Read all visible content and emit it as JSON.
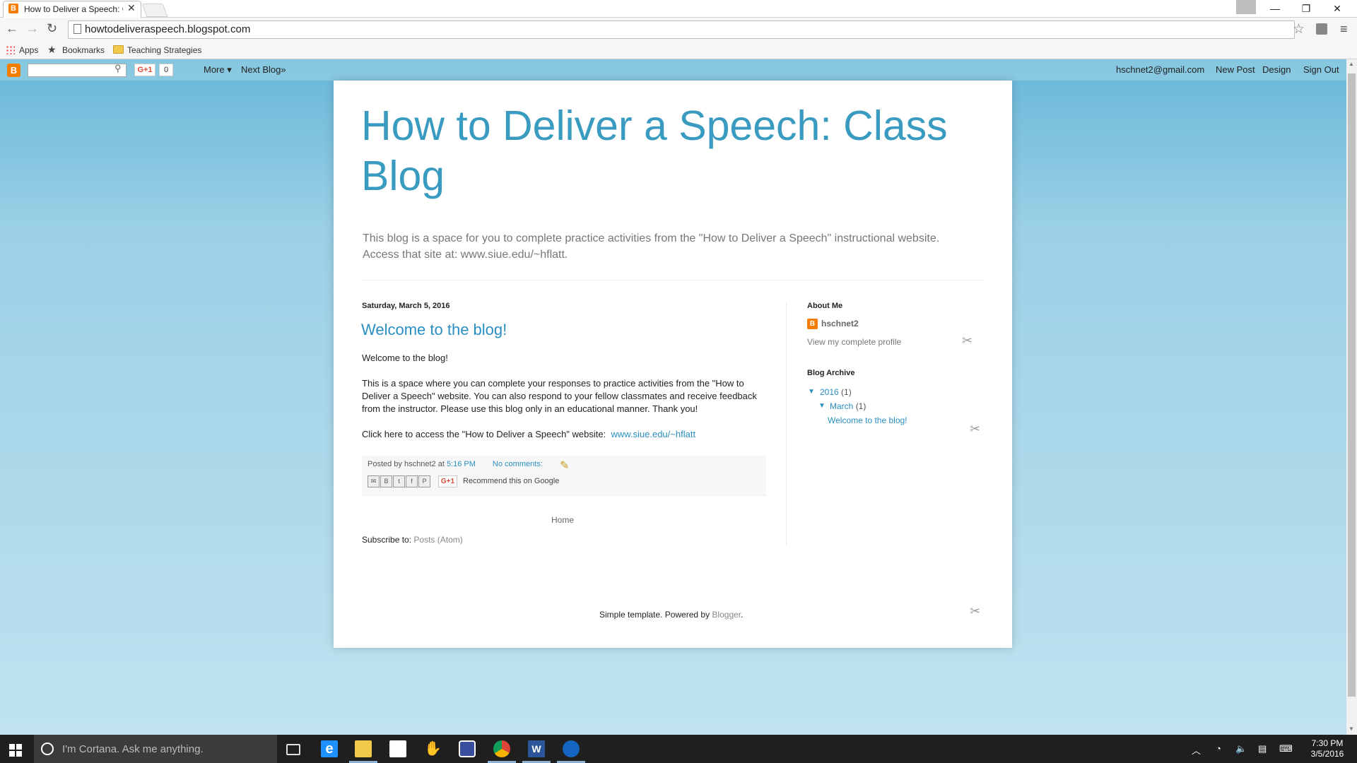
{
  "browser": {
    "tab_title": "How to Deliver a Speech: C",
    "url": "howtodeliveraspeech.blogspot.com",
    "bookmarks": [
      {
        "label": "Apps"
      },
      {
        "label": "Bookmarks"
      },
      {
        "label": "Teaching Strategies"
      }
    ]
  },
  "blogger_bar": {
    "gplus": "G+1",
    "count": "0",
    "more": "More ▾",
    "next_blog": "Next Blog»",
    "email": "hschnet2@gmail.com",
    "new_post": "New Post",
    "design": "Design",
    "sign_out": "Sign Out"
  },
  "blog": {
    "title": "How to Deliver a Speech: Class Blog",
    "description": "This blog is a space for you to complete practice activities from the \"How to Deliver a Speech\" instructional website. Access that site at: www.siue.edu/~hflatt."
  },
  "post": {
    "date": "Saturday, March 5, 2016",
    "title": "Welcome to the blog!",
    "p1": "Welcome to the blog!",
    "p2": "This is a space where you can complete your responses to practice activities from the \"How to Deliver a Speech\" website.  You can also respond to your fellow classmates and receive feedback from the instructor.  Please use this blog only in an educational manner.  Thank you!",
    "p3_prefix": "Click here to access the \"How to Deliver a Speech\" website:  ",
    "p3_link": "www.siue.edu/~hflatt",
    "posted_by_label": "Posted by",
    "author": "hschnet2",
    "at": "at",
    "time": "5:16 PM",
    "comments": "No comments:",
    "share_gplus": "G+1",
    "recommend": "Recommend this on Google"
  },
  "nav": {
    "home": "Home",
    "subscribe_label": "Subscribe to:",
    "subscribe_link": "Posts (Atom)"
  },
  "sidebar": {
    "about_heading": "About Me",
    "profile_name": "hschnet2",
    "profile_link": "View my complete profile",
    "archive_heading": "Blog Archive",
    "year": "2016",
    "year_count": "(1)",
    "month": "March",
    "month_count": "(1)",
    "archive_post": "Welcome to the blog!"
  },
  "footer": {
    "credits_prefix": "Simple template. Powered by ",
    "credits_link": "Blogger",
    "credits_suffix": "."
  },
  "taskbar": {
    "search_placeholder": "I'm Cortana. Ask me anything.",
    "time": "7:30 PM",
    "date": "3/5/2016"
  },
  "colors": {
    "title_blue": "#3a9bc0",
    "link_blue": "#2a8fc0",
    "blogger_orange": "#f57d00"
  }
}
